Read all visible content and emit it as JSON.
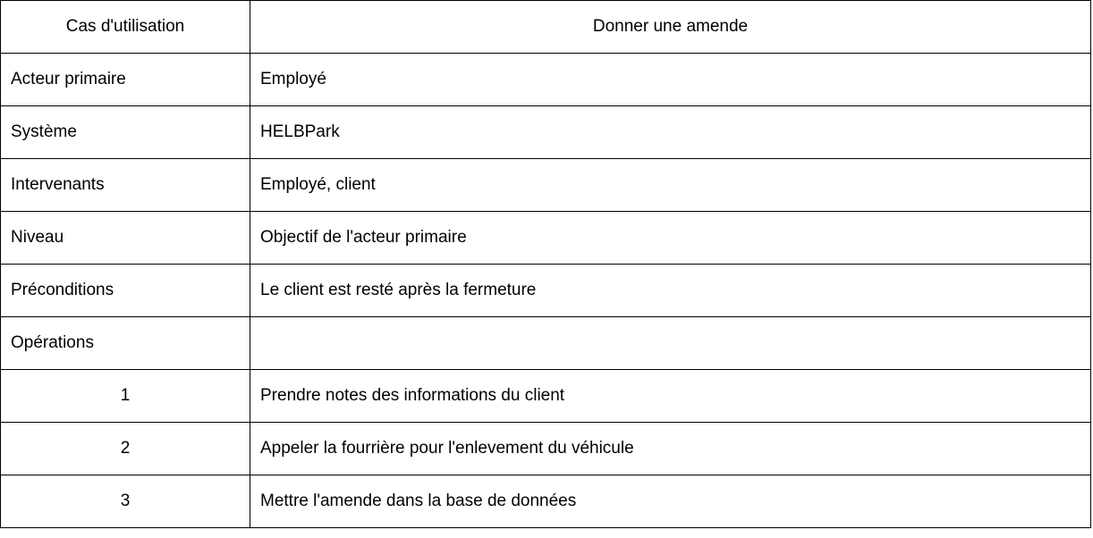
{
  "table": {
    "header": {
      "left": "Cas d'utilisation",
      "right": "Donner une amende"
    },
    "rows": [
      {
        "label": "Acteur primaire",
        "value": "Employé"
      },
      {
        "label": "Système",
        "value": "HELBPark"
      },
      {
        "label": "Intervenants",
        "value": "Employé, client"
      },
      {
        "label": "Niveau",
        "value": "Objectif de l'acteur primaire"
      },
      {
        "label": "Préconditions",
        "value": "Le client est resté après la fermeture"
      },
      {
        "label": "Opérations",
        "value": ""
      }
    ],
    "operations": [
      {
        "number": "1",
        "description": "Prendre notes des informations du client"
      },
      {
        "number": "2",
        "description": "Appeler la fourrière pour l'enlevement du véhicule"
      },
      {
        "number": "3",
        "description": "Mettre l'amende dans la base de données"
      }
    ]
  }
}
